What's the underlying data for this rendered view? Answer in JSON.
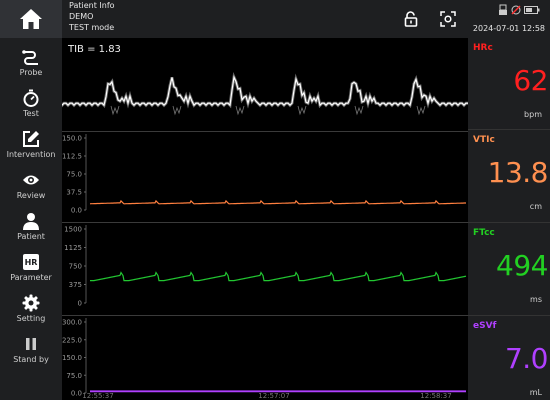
{
  "topbar": {
    "patient_info_label": "Patient Info",
    "patient_name": "DEMO",
    "mode": "TEST mode",
    "datetime": "2024-07-01 12:58",
    "icons": [
      "home-icon",
      "unlock-icon",
      "screenshot-icon",
      "usb-icon",
      "network-icon",
      "battery-icon"
    ]
  },
  "sidebar": {
    "items": [
      {
        "label": "Probe",
        "icon": "probe-icon"
      },
      {
        "label": "Test",
        "icon": "stopwatch-icon"
      },
      {
        "label": "Intervention",
        "icon": "edit-icon"
      },
      {
        "label": "Review",
        "icon": "eye-icon"
      },
      {
        "label": "Patient",
        "icon": "person-icon"
      },
      {
        "label": "Parameter",
        "icon": "hr-icon",
        "badge": "HR"
      },
      {
        "label": "Setting",
        "icon": "gear-icon"
      },
      {
        "label": "Stand by",
        "icon": "pause-icon"
      }
    ]
  },
  "doppler": {
    "tib_label": "TIB = 1.83"
  },
  "charts": [
    {
      "name": "VTI",
      "color": "#ff7f3f",
      "ticks": [
        "150.0",
        "112.5",
        "75.0",
        "37.5",
        "0.0"
      ],
      "ylim": [
        0,
        150
      ]
    },
    {
      "name": "FT",
      "color": "#22c832",
      "ticks": [
        "1500",
        "1125",
        "750",
        "375",
        "0"
      ],
      "ylim": [
        0,
        1500
      ]
    },
    {
      "name": "SV",
      "color": "#b040ff",
      "ticks": [
        "300.0",
        "225.0",
        "150.0",
        "75.0",
        "0.0"
      ],
      "ylim": [
        0,
        300
      ]
    }
  ],
  "time_axis": [
    "12:55:37",
    "12:57:07",
    "12:58:37"
  ],
  "parameters": [
    {
      "name": "HRc",
      "value": "62",
      "unit": "bpm",
      "color": "#ff2020"
    },
    {
      "name": "VTIc",
      "value": "13.8",
      "unit": "cm",
      "color": "#ff9050"
    },
    {
      "name": "FTcc",
      "value": "494",
      "unit": "ms",
      "color": "#22d022"
    },
    {
      "name": "eSVf",
      "value": "7.0",
      "unit": "mL",
      "color": "#b040ff"
    }
  ],
  "chart_data": [
    {
      "type": "line",
      "title": "",
      "xlabel": "",
      "ylabel": "",
      "ylim": [
        0,
        150
      ],
      "x": [
        "12:55:37",
        "12:57:07",
        "12:58:37"
      ],
      "series": [
        {
          "values": [
            13.8,
            13.8,
            13.8
          ]
        }
      ]
    },
    {
      "type": "line",
      "title": "",
      "xlabel": "",
      "ylabel": "",
      "ylim": [
        0,
        1500
      ],
      "x": [
        "12:55:37",
        "12:57:07",
        "12:58:37"
      ],
      "series": [
        {
          "values": [
            494,
            494,
            494
          ]
        }
      ]
    },
    {
      "type": "line",
      "title": "",
      "xlabel": "",
      "ylabel": "",
      "ylim": [
        0,
        300
      ],
      "x": [
        "12:55:37",
        "12:57:07",
        "12:58:37"
      ],
      "series": [
        {
          "values": [
            7.0,
            7.0,
            7.0
          ]
        }
      ]
    }
  ]
}
